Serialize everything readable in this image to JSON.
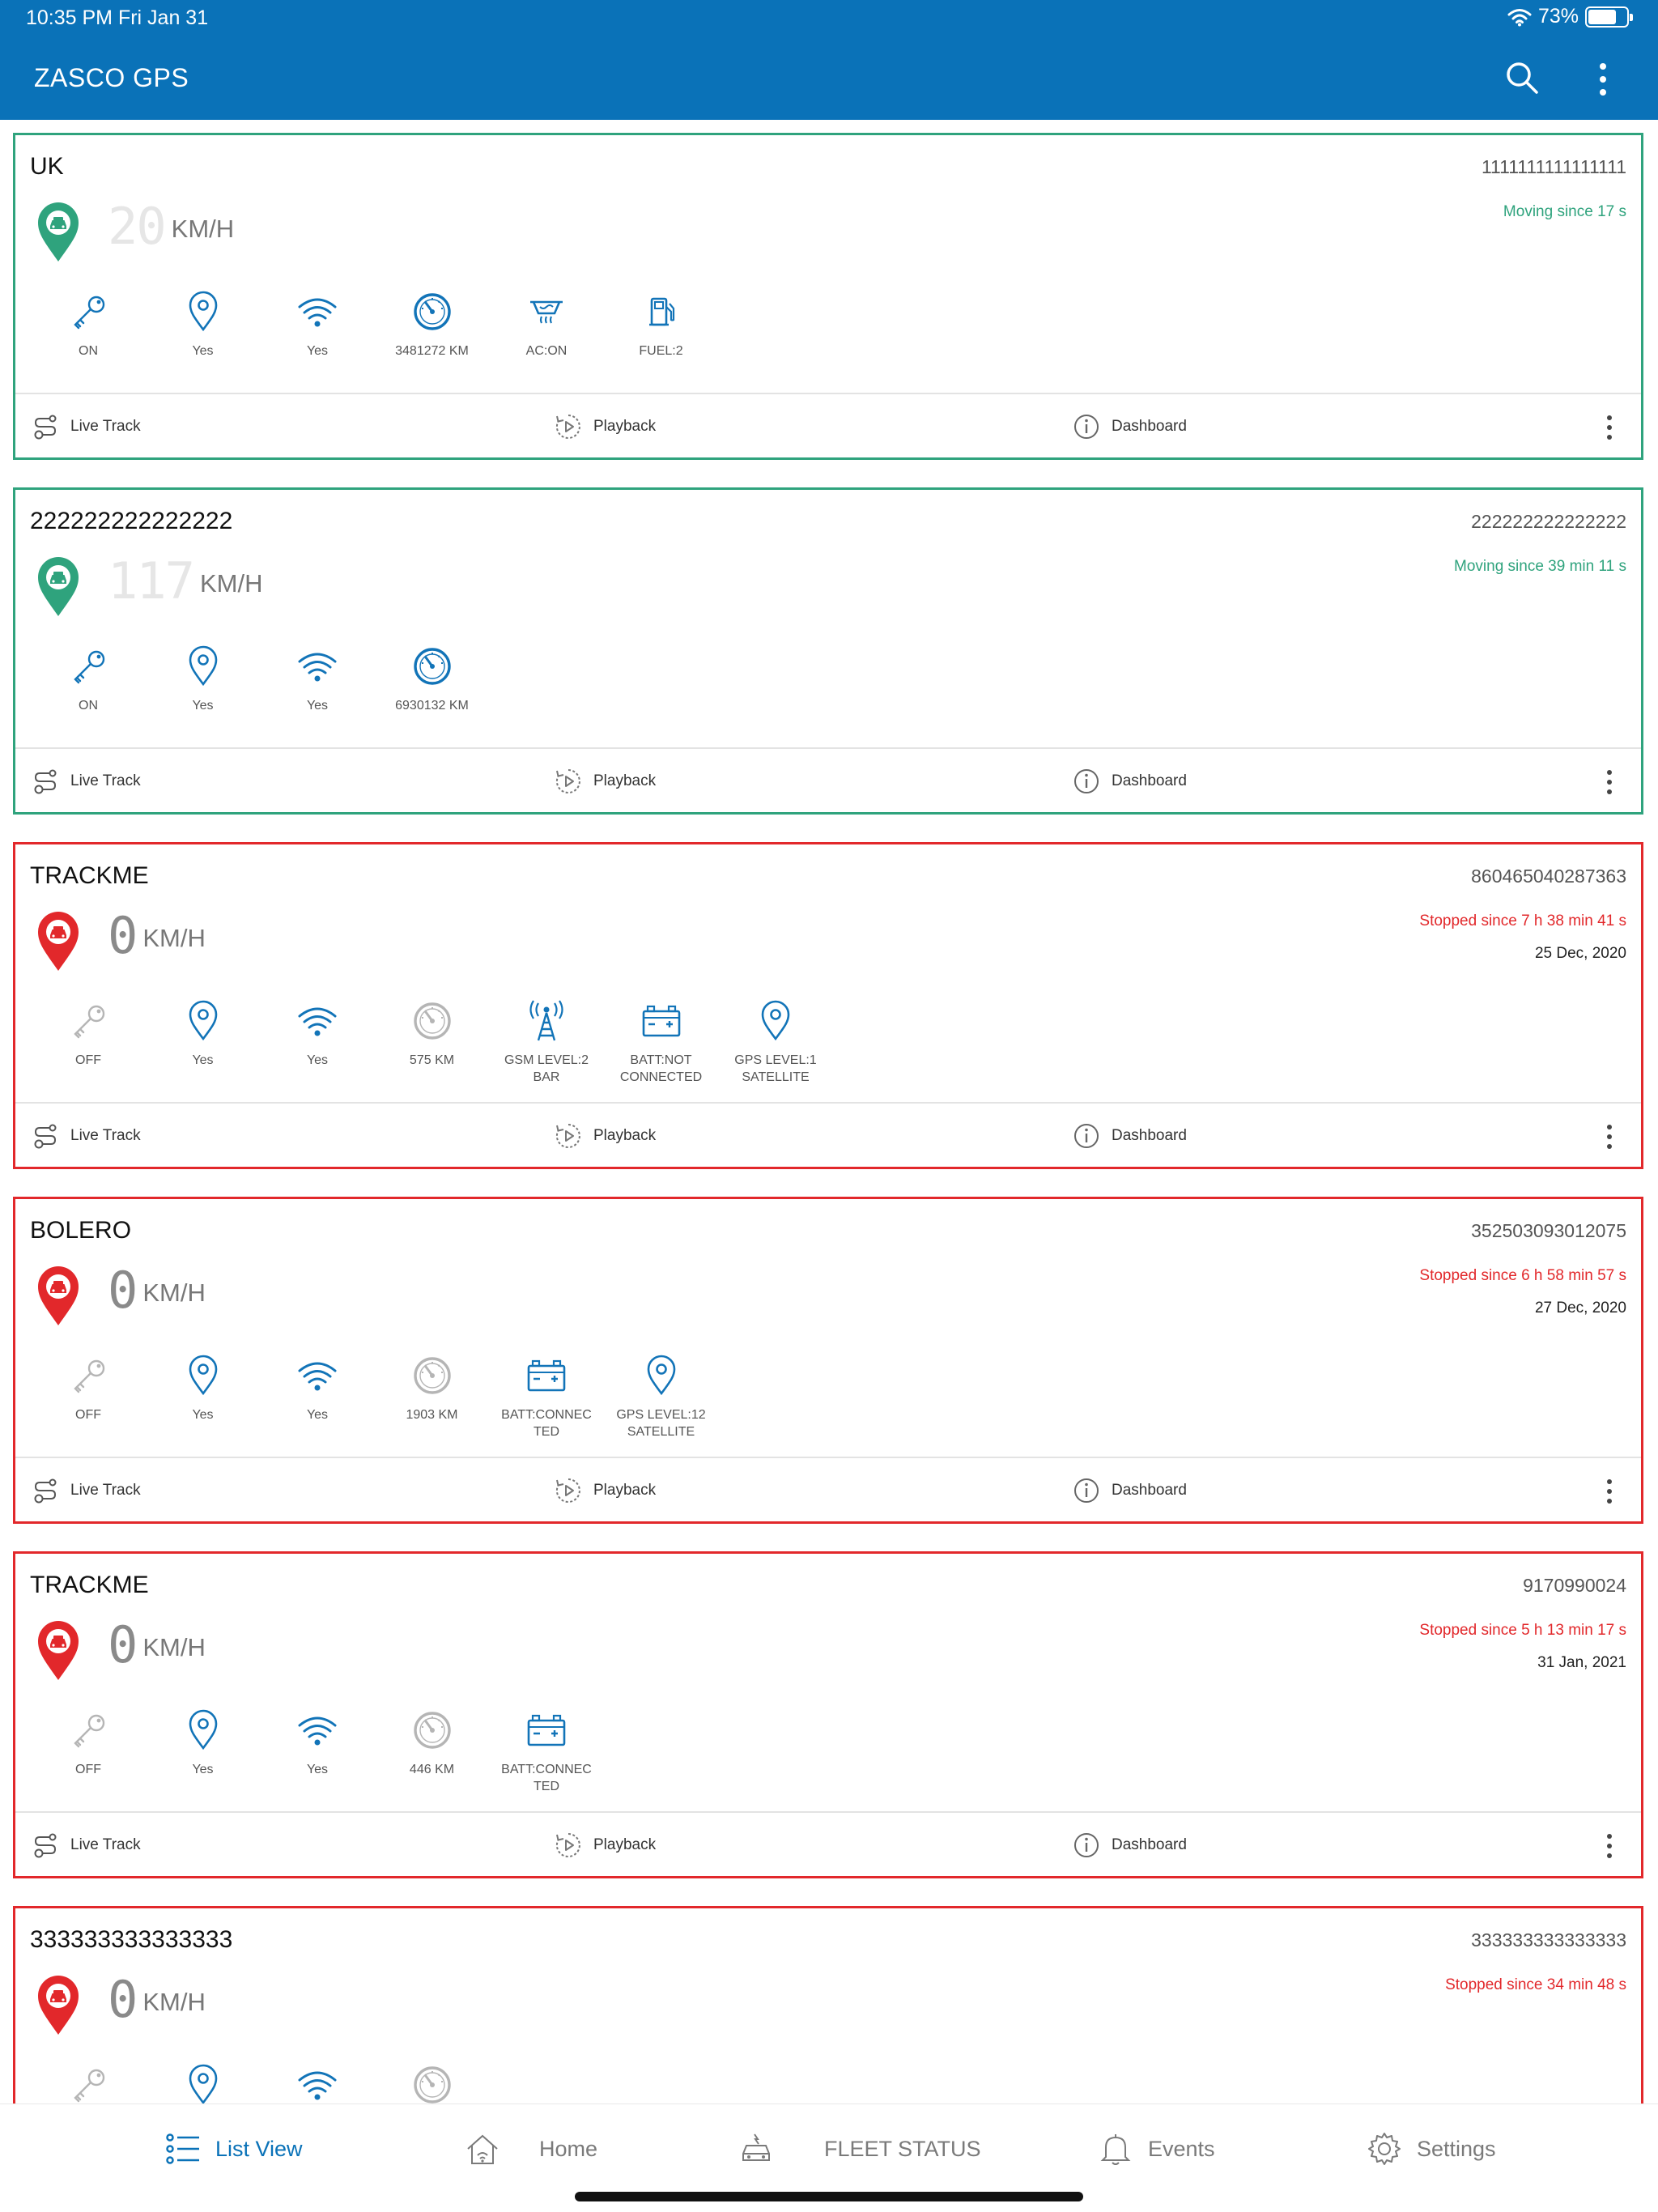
{
  "status_bar": {
    "time": "10:35 PM   Fri Jan 31",
    "battery": "73%",
    "battery_level": 0.73
  },
  "app": {
    "title": "ZASCO GPS"
  },
  "labels": {
    "live_track": "Live Track",
    "playback": "Playback",
    "dashboard": "Dashboard",
    "speed_unit": "KM/H"
  },
  "colors": {
    "brand": "#0a72b8",
    "moving": "#2fa37d",
    "stopped": "#e2282b",
    "icon_active": "#1274b8",
    "icon_inactive": "#b5b5b5"
  },
  "vehicles": [
    {
      "name": "UK",
      "id": "1111111111111111",
      "speed": "20",
      "status": "Moving",
      "status_text": "Moving  since 17 s",
      "date": "",
      "indicators": [
        {
          "icon": "key-icon",
          "label": "ON",
          "active": true
        },
        {
          "icon": "gps-pin-icon",
          "label": "Yes",
          "active": true
        },
        {
          "icon": "wifi-icon",
          "label": "Yes",
          "active": true
        },
        {
          "icon": "odometer-icon",
          "label": "3481272 KM",
          "active": true
        },
        {
          "icon": "ac-icon",
          "label": "AC:ON",
          "active": true
        },
        {
          "icon": "fuel-icon",
          "label": "FUEL:2",
          "active": true
        }
      ]
    },
    {
      "name": "222222222222222",
      "id": "222222222222222",
      "speed": "117",
      "status": "Moving",
      "status_text": "Moving  since 39 min 11 s",
      "date": "",
      "indicators": [
        {
          "icon": "key-icon",
          "label": "ON",
          "active": true
        },
        {
          "icon": "gps-pin-icon",
          "label": "Yes",
          "active": true
        },
        {
          "icon": "wifi-icon",
          "label": "Yes",
          "active": true
        },
        {
          "icon": "odometer-icon",
          "label": "6930132 KM",
          "active": true
        }
      ]
    },
    {
      "name": "TRACKME",
      "id": "860465040287363",
      "speed": "0",
      "status": "Stopped",
      "status_text": "Stopped  since 7 h 38 min 41 s",
      "date": "25 Dec, 2020",
      "indicators": [
        {
          "icon": "key-icon",
          "label": "OFF",
          "active": false
        },
        {
          "icon": "gps-pin-icon",
          "label": "Yes",
          "active": true
        },
        {
          "icon": "wifi-icon",
          "label": "Yes",
          "active": true
        },
        {
          "icon": "odometer-icon",
          "label": "575 KM",
          "active": false
        },
        {
          "icon": "gsm-tower-icon",
          "label": "GSM LEVEL:2\nBAR",
          "active": true
        },
        {
          "icon": "battery-icon",
          "label": "BATT:NOT\nCONNECTED",
          "active": true
        },
        {
          "icon": "gps-pin-icon",
          "label": "GPS LEVEL:1\nSATELLITE",
          "active": true
        }
      ]
    },
    {
      "name": "BOLERO",
      "id": "352503093012075",
      "speed": "0",
      "status": "Stopped",
      "status_text": "Stopped  since 6 h 58 min 57 s",
      "date": "27 Dec, 2020",
      "indicators": [
        {
          "icon": "key-icon",
          "label": "OFF",
          "active": false
        },
        {
          "icon": "gps-pin-icon",
          "label": "Yes",
          "active": true
        },
        {
          "icon": "wifi-icon",
          "label": "Yes",
          "active": true
        },
        {
          "icon": "odometer-icon",
          "label": "1903 KM",
          "active": false
        },
        {
          "icon": "battery-icon",
          "label": "BATT:CONNEC\nTED",
          "active": true
        },
        {
          "icon": "gps-pin-icon",
          "label": "GPS LEVEL:12\nSATELLITE",
          "active": true
        }
      ]
    },
    {
      "name": "TRACKME",
      "id": "9170990024",
      "speed": "0",
      "status": "Stopped",
      "status_text": "Stopped  since 5 h 13 min 17 s",
      "date": "31 Jan, 2021",
      "indicators": [
        {
          "icon": "key-icon",
          "label": "OFF",
          "active": false
        },
        {
          "icon": "gps-pin-icon",
          "label": "Yes",
          "active": true
        },
        {
          "icon": "wifi-icon",
          "label": "Yes",
          "active": true
        },
        {
          "icon": "odometer-icon",
          "label": "446 KM",
          "active": false
        },
        {
          "icon": "battery-icon",
          "label": "BATT:CONNEC\nTED",
          "active": true
        }
      ]
    },
    {
      "name": "333333333333333",
      "id": "333333333333333",
      "speed": "0",
      "status": "Stopped",
      "status_text": "Stopped  since 34 min 48 s",
      "date": "",
      "indicators": [
        {
          "icon": "key-icon",
          "label": "",
          "active": false
        },
        {
          "icon": "gps-pin-icon",
          "label": "",
          "active": true
        },
        {
          "icon": "wifi-icon",
          "label": "",
          "active": true
        },
        {
          "icon": "odometer-icon",
          "label": "",
          "active": false
        }
      ]
    }
  ],
  "tabs": [
    {
      "icon": "list-icon",
      "label": "List View",
      "active": true
    },
    {
      "icon": "home-icon",
      "label": "Home",
      "active": false
    },
    {
      "icon": "fleet-car-icon",
      "label": "FLEET STATUS",
      "active": false
    },
    {
      "icon": "bell-icon",
      "label": "Events",
      "active": false
    },
    {
      "icon": "gear-icon",
      "label": "Settings",
      "active": false
    }
  ]
}
